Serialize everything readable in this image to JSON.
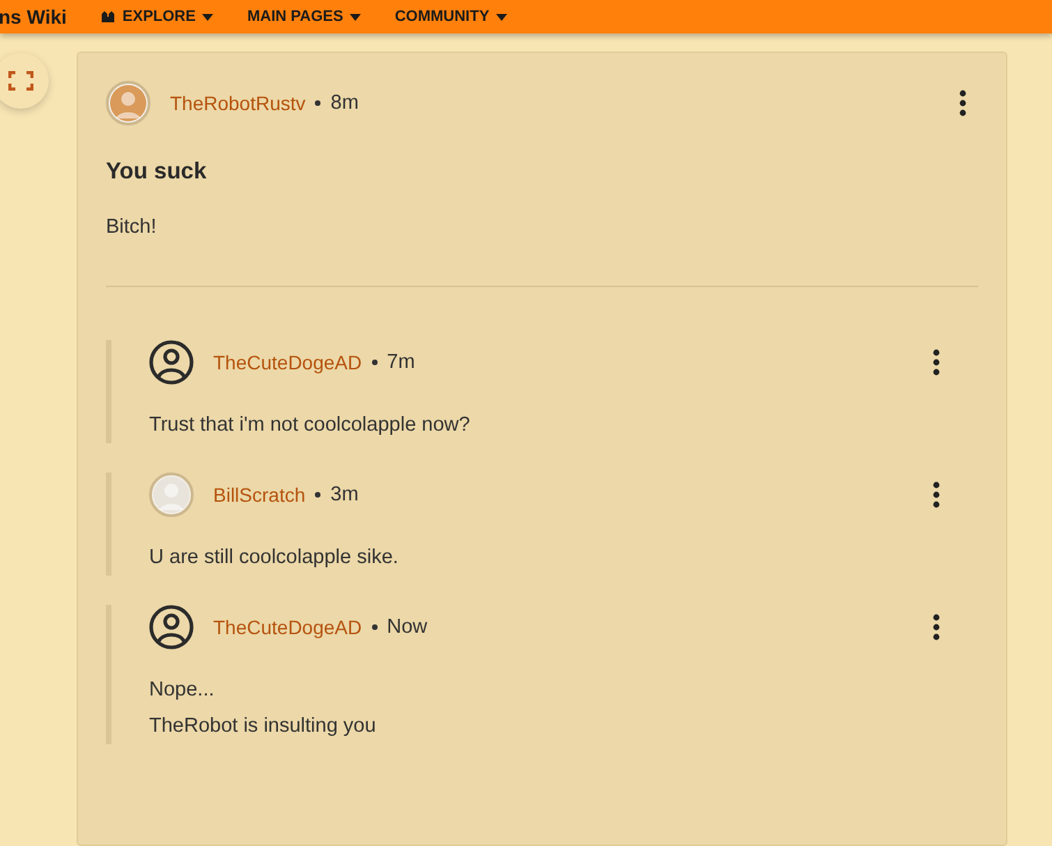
{
  "top_nav": {
    "site_title": "ns Wiki",
    "items": [
      {
        "label": "EXPLORE",
        "kind": "explore"
      },
      {
        "label": "MAIN PAGES",
        "kind": "plain"
      },
      {
        "label": "COMMUNITY",
        "kind": "plain"
      }
    ]
  },
  "post": {
    "author": "TheRobotRustv",
    "avatar": {
      "kind": "image",
      "color": "#d99a5a"
    },
    "time": "8m",
    "title": "You suck",
    "body": "Bitch!",
    "replies": [
      {
        "author": "TheCuteDogeAD",
        "avatar": {
          "kind": "default"
        },
        "time": "7m",
        "lines": [
          "Trust that i'm not coolcolapple now?"
        ]
      },
      {
        "author": "BillScratch",
        "avatar": {
          "kind": "image",
          "color": "#e8e4dc"
        },
        "time": "3m",
        "lines": [
          "U are still coolcolapple sike."
        ]
      },
      {
        "author": "TheCuteDogeAD",
        "avatar": {
          "kind": "default"
        },
        "time": "Now",
        "lines": [
          "Nope...",
          "TheRobot is insulting you"
        ]
      }
    ]
  }
}
